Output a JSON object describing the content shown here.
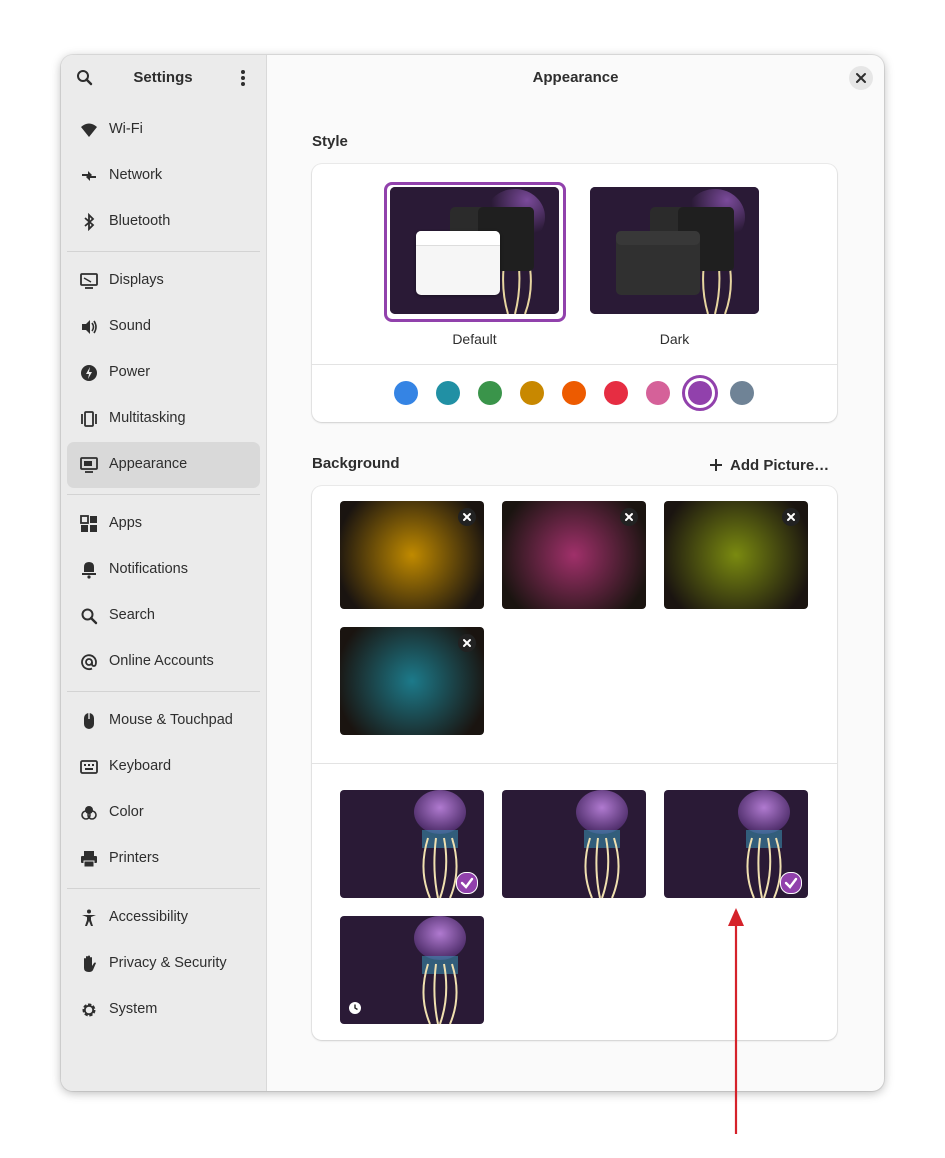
{
  "sidebar": {
    "title": "Settings",
    "search_icon": "search-icon",
    "menu_icon": "vertical-dots-icon",
    "groups": [
      [
        {
          "label": "Wi-Fi",
          "icon": "wifi-icon"
        },
        {
          "label": "Network",
          "icon": "network-icon"
        },
        {
          "label": "Bluetooth",
          "icon": "bluetooth-icon"
        }
      ],
      [
        {
          "label": "Displays",
          "icon": "display-icon"
        },
        {
          "label": "Sound",
          "icon": "speaker-icon"
        },
        {
          "label": "Power",
          "icon": "power-icon"
        },
        {
          "label": "Multitasking",
          "icon": "multitasking-icon"
        },
        {
          "label": "Appearance",
          "icon": "appearance-icon",
          "active": true
        }
      ],
      [
        {
          "label": "Apps",
          "icon": "apps-grid-icon"
        },
        {
          "label": "Notifications",
          "icon": "notifications-icon"
        },
        {
          "label": "Search",
          "icon": "search-icon"
        },
        {
          "label": "Online Accounts",
          "icon": "at-sign-icon"
        }
      ],
      [
        {
          "label": "Mouse & Touchpad",
          "icon": "mouse-icon"
        },
        {
          "label": "Keyboard",
          "icon": "keyboard-icon"
        },
        {
          "label": "Color",
          "icon": "color-icon"
        },
        {
          "label": "Printers",
          "icon": "printer-icon"
        }
      ],
      [
        {
          "label": "Accessibility",
          "icon": "accessibility-icon"
        },
        {
          "label": "Privacy & Security",
          "icon": "hand-icon"
        },
        {
          "label": "System",
          "icon": "gear-icon"
        }
      ]
    ]
  },
  "content": {
    "title": "Appearance",
    "close_icon": "close-icon"
  },
  "style": {
    "heading": "Style",
    "options": [
      {
        "label": "Default",
        "selected": true
      },
      {
        "label": "Dark",
        "selected": false
      }
    ],
    "accents": [
      "#3584e4",
      "#2190a4",
      "#3a944a",
      "#c88800",
      "#ed5b00",
      "#e62d42",
      "#d56199",
      "#9141ac",
      "#6f8396"
    ],
    "selected_accent": "#9141ac"
  },
  "background": {
    "heading": "Background",
    "add_label": "Add Picture…",
    "custom_colors": [
      "#c08a00",
      "#a0306a",
      "#7a8a10",
      "#1c7a8a"
    ],
    "wallpapers": [
      {
        "selected": true,
        "icon": "check-icon"
      },
      {
        "selected": false
      },
      {
        "selected": true,
        "icon": "check-icon"
      },
      {
        "selected": false,
        "icon": "clock-icon"
      }
    ]
  }
}
